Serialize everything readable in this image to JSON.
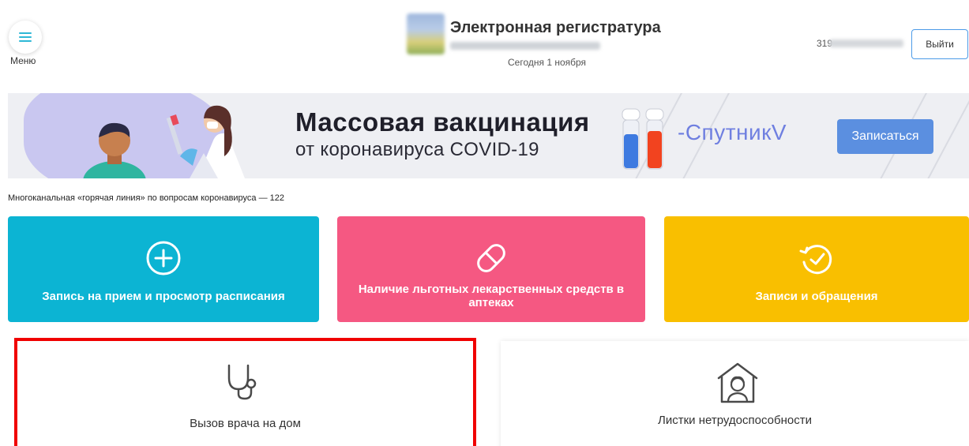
{
  "header": {
    "menu_label": "Меню",
    "app_title": "Электронная регистратура",
    "today_text": "Сегодня 1 ноября",
    "user_prefix": "319",
    "logout_label": "Выйти"
  },
  "banner": {
    "title": "Массовая вакцинация",
    "subtitle": "от коронавируса COVID-19",
    "brand": "-СпутникV",
    "cta_label": "Записаться"
  },
  "hotline_text": "Многоканальная «горячая линия» по вопросам коронавируса — 122",
  "tiles": [
    {
      "label": "Запись на прием и просмотр расписания",
      "icon": "plus-circle-icon",
      "color": "#0cb4d3"
    },
    {
      "label": "Наличие льготных лекарственных средств в аптеках",
      "icon": "pill-icon",
      "color": "#f55882"
    },
    {
      "label": "Записи и обращения",
      "icon": "history-clock-icon",
      "color": "#f9bf00"
    }
  ],
  "cards": [
    {
      "label": "Вызов врача на дом",
      "icon": "stethoscope-icon",
      "highlighted": true,
      "highlight_color": "#f00000"
    },
    {
      "label": "Листки нетрудоспособности",
      "icon": "house-person-icon"
    }
  ],
  "colors": {
    "accent": "#2eb8d6",
    "button_blue": "#5b8fe0"
  }
}
